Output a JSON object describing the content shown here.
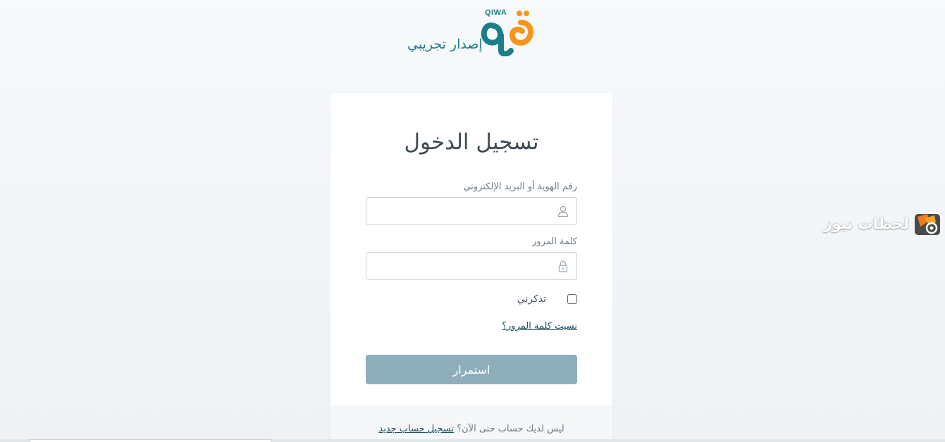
{
  "header": {
    "logo_latin": "QIWA",
    "logo_subtitle": "إصدار تجريبي",
    "colors": {
      "brand_orange": "#f7941d",
      "brand_teal": "#1b7f86"
    }
  },
  "login": {
    "title": "تسجيل الدخول",
    "id_label": "رقم الهوية أو البريد الإلكتروني",
    "id_value": "",
    "id_icon": "user-icon",
    "password_label": "كلمة المرور",
    "password_value": "",
    "password_icon": "lock-icon",
    "remember_label": "تذكرني",
    "remember_checked": false,
    "forgot_link": "نسيت كلمة المرور؟",
    "submit_label": "استمرار",
    "submit_color": "#8faebc"
  },
  "footer": {
    "prompt": "ليس لديك حساب حتى الآن؟",
    "register_link": "تسجيل حساب جديد"
  },
  "watermark": {
    "text": "لحظات نيوز"
  }
}
